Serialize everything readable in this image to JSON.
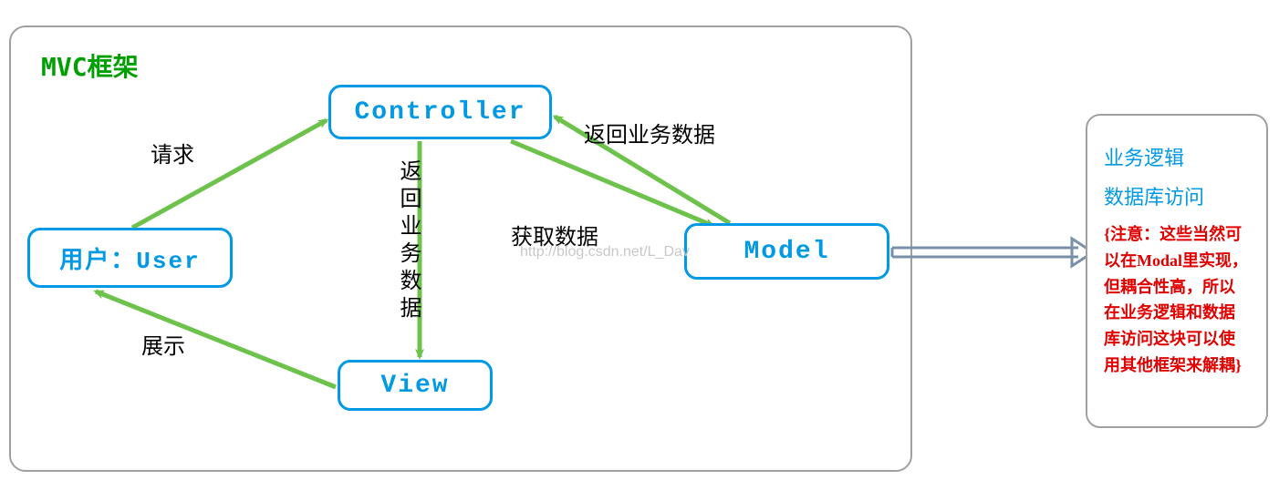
{
  "frame": {
    "title": "MVC框架"
  },
  "nodes": {
    "user": "用户：User",
    "controller": "Controller",
    "view": "View",
    "model": "Model"
  },
  "labels": {
    "request": "请求",
    "display": "展示",
    "return_biz_data_v": "返回业务数据",
    "get_data": "获取数据",
    "return_biz_data": "返回业务数据"
  },
  "watermark": "http://blog.csdn.net/L_Dav",
  "note": {
    "title_line1": "业务逻辑",
    "title_line2": "数据库访问",
    "body": "{注意：这些当然可以在Modal里实现，但耦合性高，所以在业务逻辑和数据库访问这块可以使用其他框架来解耦}"
  }
}
